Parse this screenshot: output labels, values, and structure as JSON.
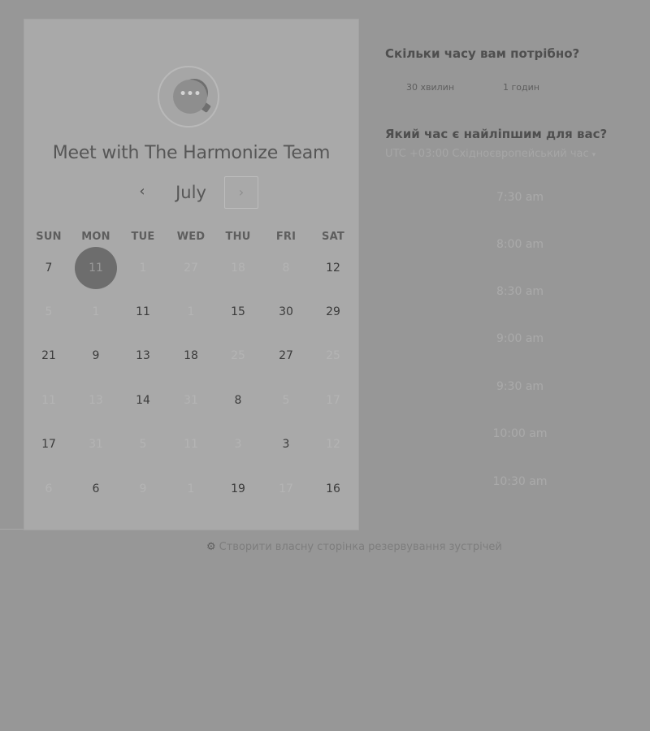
{
  "calendar": {
    "title": "Meet with The Harmonize Team",
    "avatar_icon": "chat-bubble-icon",
    "avatar_glyph": "•••",
    "month": "July",
    "prev_label": "‹",
    "next_label": "›",
    "weekdays": [
      "SUN",
      "MON",
      "TUE",
      "WED",
      "THU",
      "FRI",
      "SAT"
    ],
    "weeks": [
      [
        {
          "label": "7",
          "state": "active"
        },
        {
          "label": "11",
          "state": "selected"
        },
        {
          "label": "1",
          "state": "muted"
        },
        {
          "label": "27",
          "state": "muted"
        },
        {
          "label": "18",
          "state": "muted"
        },
        {
          "label": "8",
          "state": "muted"
        },
        {
          "label": "12",
          "state": "active"
        }
      ],
      [
        {
          "label": "5",
          "state": "muted"
        },
        {
          "label": "1",
          "state": "muted"
        },
        {
          "label": "11",
          "state": "active"
        },
        {
          "label": "1",
          "state": "muted"
        },
        {
          "label": "15",
          "state": "active"
        },
        {
          "label": "30",
          "state": "active"
        },
        {
          "label": "29",
          "state": "active"
        }
      ],
      [
        {
          "label": "21",
          "state": "active"
        },
        {
          "label": "9",
          "state": "active"
        },
        {
          "label": "13",
          "state": "active"
        },
        {
          "label": "18",
          "state": "active"
        },
        {
          "label": "25",
          "state": "muted"
        },
        {
          "label": "27",
          "state": "active"
        },
        {
          "label": "25",
          "state": "muted"
        }
      ],
      [
        {
          "label": "11",
          "state": "muted"
        },
        {
          "label": "13",
          "state": "muted"
        },
        {
          "label": "14",
          "state": "active"
        },
        {
          "label": "31",
          "state": "muted"
        },
        {
          "label": "8",
          "state": "active"
        },
        {
          "label": "5",
          "state": "muted"
        },
        {
          "label": "17",
          "state": "muted"
        }
      ],
      [
        {
          "label": "17",
          "state": "active"
        },
        {
          "label": "31",
          "state": "muted"
        },
        {
          "label": "5",
          "state": "muted"
        },
        {
          "label": "11",
          "state": "muted"
        },
        {
          "label": "3",
          "state": "muted"
        },
        {
          "label": "3",
          "state": "active"
        },
        {
          "label": "12",
          "state": "muted"
        }
      ],
      [
        {
          "label": "6",
          "state": "muted"
        },
        {
          "label": "6",
          "state": "active"
        },
        {
          "label": "9",
          "state": "muted"
        },
        {
          "label": "1",
          "state": "muted"
        },
        {
          "label": "19",
          "state": "active"
        },
        {
          "label": "17",
          "state": "muted"
        },
        {
          "label": "16",
          "state": "active"
        }
      ]
    ]
  },
  "booking": {
    "duration_question": "Скільки часу вам потрібно?",
    "durations": [
      "30 хвилин",
      "1 годин"
    ],
    "time_question": "Який час є найліпшим для вас?",
    "timezone": "UTC +03:00 Східноєвропейський час",
    "timezone_arrow": "▾",
    "slots": [
      "7:30 am",
      "8:00 am",
      "8:30 am",
      "9:00 am",
      "9:30 am",
      "10:00 am",
      "10:30 am"
    ]
  },
  "footer": {
    "link_text": "Створити власну сторінка резервування зустрічей",
    "icon": "sprocket-icon"
  },
  "colors": {
    "overlay": "#979797",
    "card": "#a9a9a9",
    "selected_day": "#6d6d6d"
  }
}
